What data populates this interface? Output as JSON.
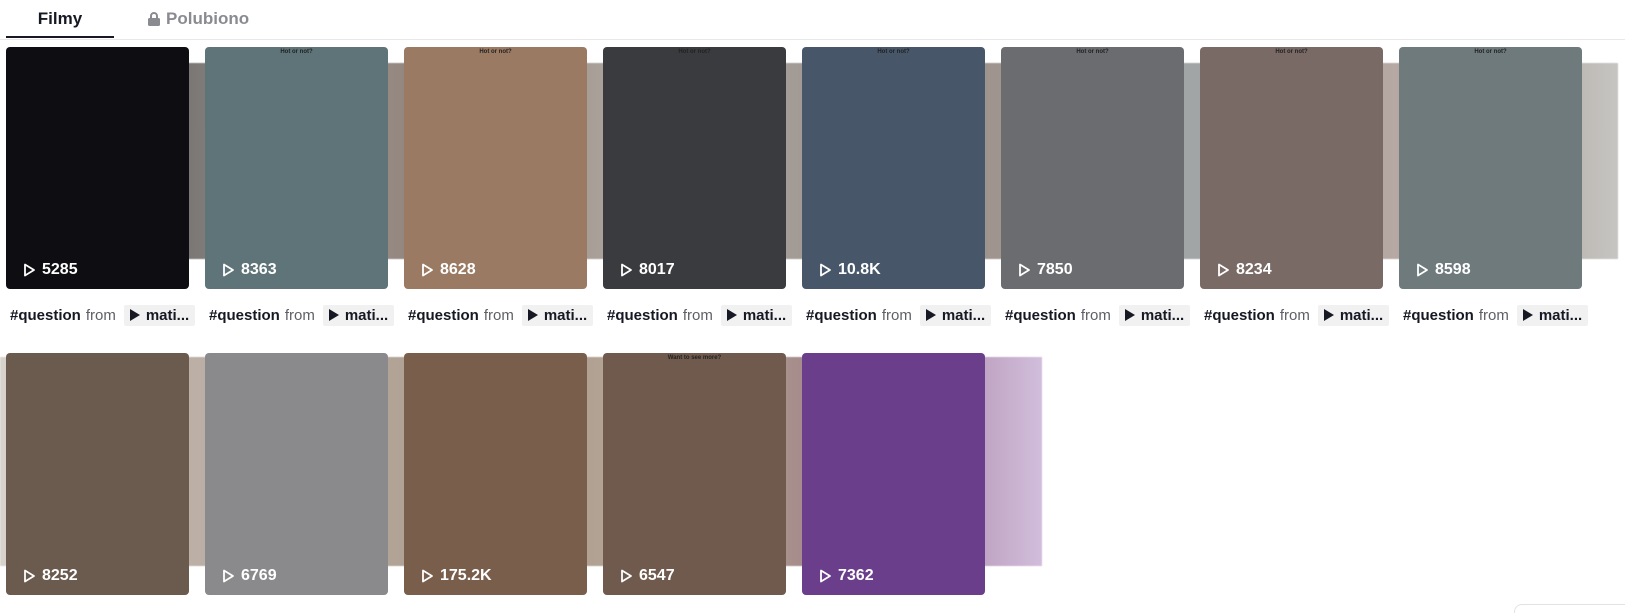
{
  "tabs": {
    "videos": "Filmy",
    "liked": "Polubiono"
  },
  "row1": [
    {
      "views": "5285",
      "bg": "#0e0e12",
      "overlay": ""
    },
    {
      "views": "8363",
      "bg": "#5e7478",
      "overlay": "Hot or not?"
    },
    {
      "views": "8628",
      "bg": "#9a7a62",
      "overlay": "Hot or not?"
    },
    {
      "views": "8017",
      "bg": "#3a3b3e",
      "overlay": "Hot or not?"
    },
    {
      "views": "10.8K",
      "bg": "#475769",
      "overlay": "Hot or not?"
    },
    {
      "views": "7850",
      "bg": "#6a6c70",
      "overlay": "Hot or not?"
    },
    {
      "views": "8234",
      "bg": "#7a6a66",
      "overlay": "Hot or not?"
    },
    {
      "views": "8598",
      "bg": "#6f7a7d",
      "overlay": "Hot or not?"
    }
  ],
  "captions": {
    "tag": "#question",
    "from": "from",
    "sound": "mati..."
  },
  "row2": [
    {
      "views": "8252",
      "bg": "#6b5a4e"
    },
    {
      "views": "6769",
      "bg": "#8a8a8c"
    },
    {
      "views": "175.2K",
      "bg": "#7a5e4c"
    },
    {
      "views": "6547",
      "bg": "#6f5a4d",
      "overlay": "Want to see more?"
    },
    {
      "views": "7362",
      "bg": "#6a3e8a"
    }
  ]
}
